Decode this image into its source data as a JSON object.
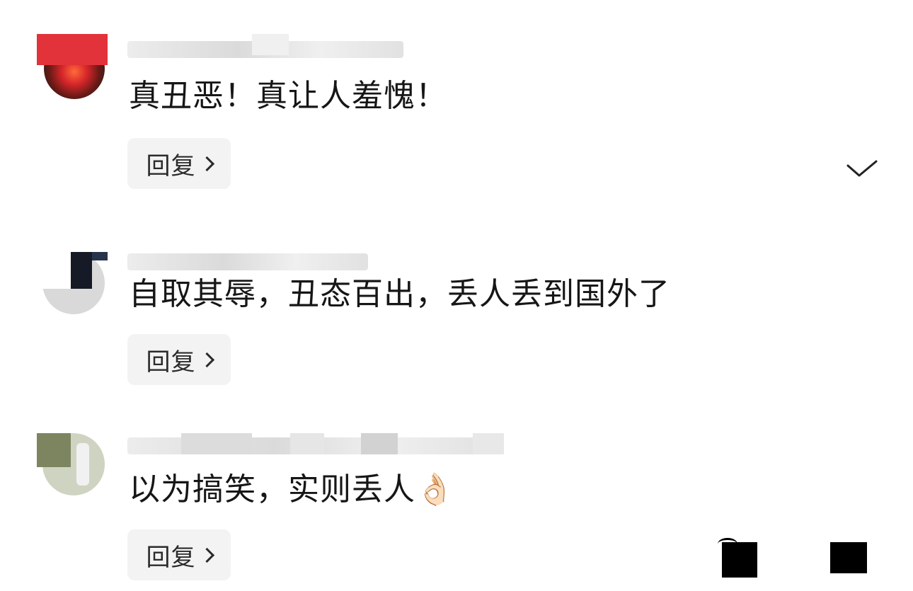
{
  "comments": [
    {
      "text": "真丑恶！真让人羞愧！",
      "reply_label": "回复"
    },
    {
      "text": "自取其辱，丑态百出，丢人丢到国外了",
      "reply_label": "回复"
    },
    {
      "text": "以为搞笑，实则丢人",
      "emoji": "👌🏻",
      "reply_label": "回复"
    }
  ],
  "icons": {
    "check": "check-icon",
    "reply_chevron": "chevron-right-icon"
  },
  "colors": {
    "reply_button_bg": "#f3f3f4",
    "text": "#161616",
    "avatar_cover_red": "#e2323a"
  }
}
